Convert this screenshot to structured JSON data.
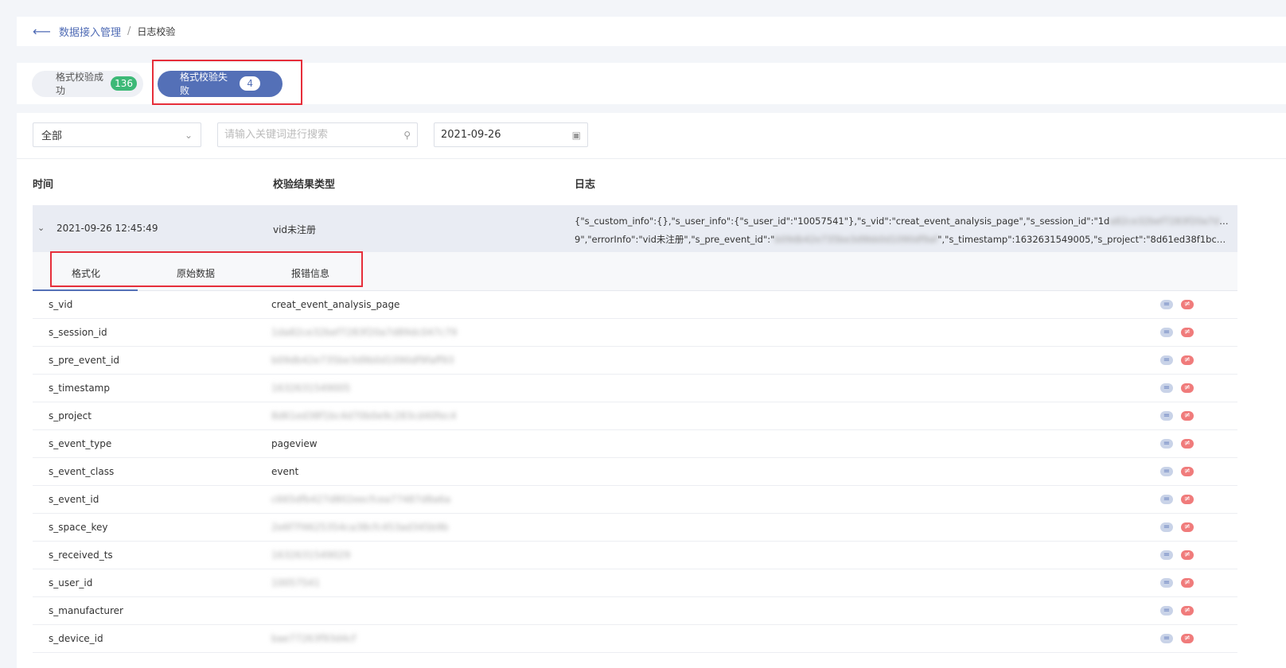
{
  "breadcrumb": {
    "back_icon": "arrow-left-icon",
    "parent": "数据接入管理",
    "separator": "/",
    "current": "日志校验"
  },
  "status_tabs": [
    {
      "label": "格式校验成功",
      "count": "136",
      "active": false
    },
    {
      "label": "格式校验失败",
      "count": "4",
      "active": true
    }
  ],
  "filters": {
    "select_value": "全部",
    "search_placeholder": "请输入关键词进行搜索",
    "date_value": "2021-09-26"
  },
  "table": {
    "headers": [
      "时间",
      "校验结果类型",
      "日志"
    ],
    "row": {
      "time": "2021-09-26 12:45:49",
      "type": "vid未注册",
      "log_line1": "{\"s_custom_info\":{},\"s_user_info\":{\"s_user_id\":\"10057541\"},\"s_vid\":\"creat_event_analysis_page\",\"s_session_id\":\"1d",
      "log_line1_blurred": "a82ce32bef7283f20a7d89dc047c7",
      "log_line2_start": "9\",\"errorInfo\":\"vid未注册\",\"s_pre_event_id\":\"",
      "log_line2_blurred": "b09db42e735be3d9bb0d1090df9af",
      "log_line2_end": "\",\"s_timestamp\":1632631549005,\"s_project\":\"8d61ed38f1bc4d70..."
    }
  },
  "detail_tabs": [
    "格式化",
    "原始数据",
    "报错信息"
  ],
  "fields": [
    {
      "key": "s_vid",
      "value": "creat_event_analysis_page",
      "blurred": false
    },
    {
      "key": "s_session_id",
      "value": "1da82ce32bef7283f20a7d89dc047c79",
      "blurred": true
    },
    {
      "key": "s_pre_event_id",
      "value": "b09db42e735be3d9b0d1090df9faff93",
      "blurred": true
    },
    {
      "key": "s_timestamp",
      "value": "1632631549005",
      "blurred": true
    },
    {
      "key": "s_project",
      "value": "8d61ed38f1bc4d70b0e9c283cd40fec4",
      "blurred": true
    },
    {
      "key": "s_event_type",
      "value": "pageview",
      "blurred": false
    },
    {
      "key": "s_event_class",
      "value": "event",
      "blurred": false
    },
    {
      "key": "s_event_id",
      "value": "c665dfb427d802eecfcea77487d8a6a",
      "blurred": true
    },
    {
      "key": "s_space_key",
      "value": "2e6f7f4625354ca38cfc453ad345b9b",
      "blurred": true
    },
    {
      "key": "s_received_ts",
      "value": "1632631549029",
      "blurred": true
    },
    {
      "key": "s_user_id",
      "value": "10057541",
      "blurred": true
    },
    {
      "key": "s_manufacturer",
      "value": "",
      "blurred": false
    },
    {
      "key": "s_device_id",
      "value": "bae77263f93d4cf",
      "blurred": true
    }
  ],
  "row_actions": {
    "equal_label": "=",
    "not_equal_label": "≠"
  },
  "colors": {
    "accent": "#5470b7",
    "success": "#3db977",
    "danger": "#f07b7b",
    "highlight": "#e62e3a"
  }
}
